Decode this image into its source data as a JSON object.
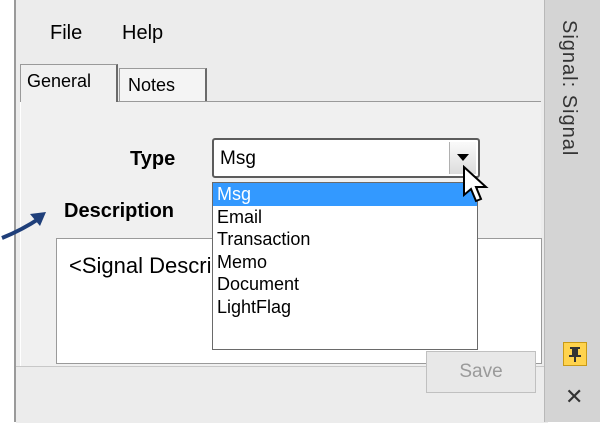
{
  "menu": {
    "file": "File",
    "help": "Help"
  },
  "tabs": [
    {
      "label": "General",
      "active": true
    },
    {
      "label": "Notes",
      "active": false
    }
  ],
  "form": {
    "type_label": "Type",
    "type_value": "Msg",
    "description_label": "Description",
    "description_value": "<Signal Description>"
  },
  "dropdown": {
    "options": [
      "Msg",
      "Email",
      "Transaction",
      "Memo",
      "Document",
      "LightFlag"
    ],
    "selected_index": 0
  },
  "footer": {
    "save_label": "Save"
  },
  "sidebar": {
    "title": "Signal: Signal",
    "pin_icon": "pin-icon",
    "close_icon": "close-icon"
  },
  "colors": {
    "selection": "#3399ff",
    "pin": "#ffd34d"
  }
}
